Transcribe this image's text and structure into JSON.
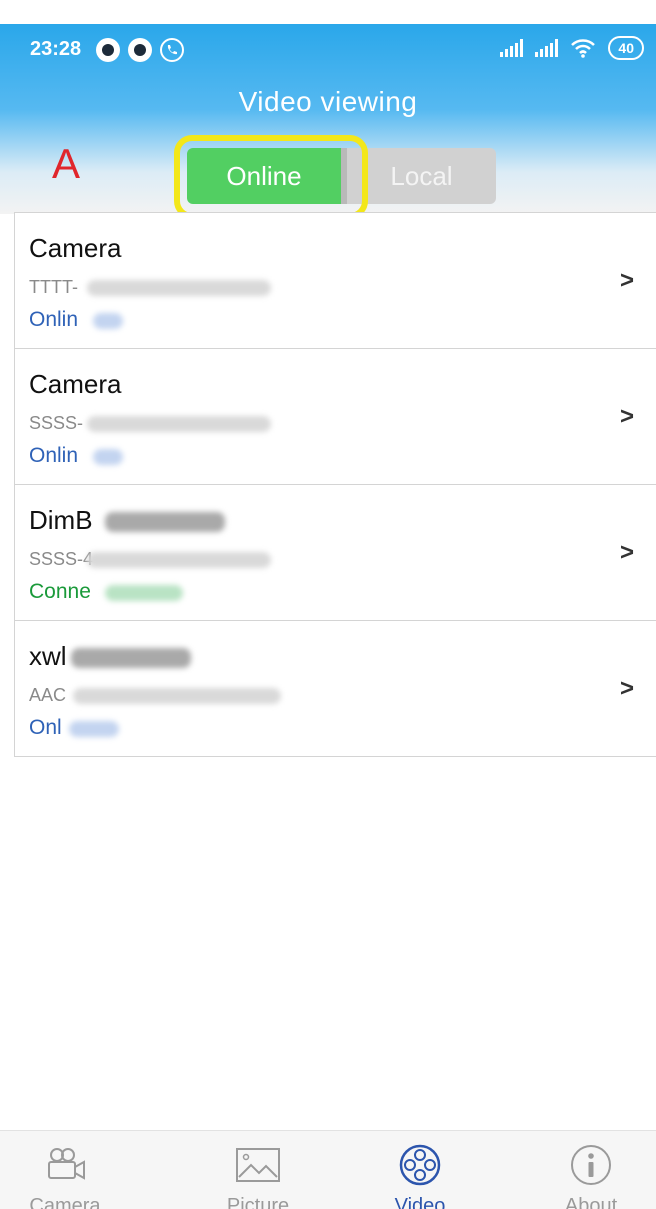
{
  "status_bar": {
    "time": "23:28",
    "battery": "40"
  },
  "header": {
    "title": "Video viewing",
    "annotation_letter": "A"
  },
  "segments": {
    "online": "Online",
    "local": "Local",
    "selected": "Online"
  },
  "devices": [
    {
      "name": "Camera",
      "id": "TTTT-",
      "status": "Onlin"
    },
    {
      "name": "Camera",
      "id": "SSSS-",
      "status": "Onlin"
    },
    {
      "name": "DimB",
      "id": "SSSS-4",
      "status": "Conne"
    },
    {
      "name": "xwl",
      "id": "AAC",
      "status": "Onl"
    }
  ],
  "bottom_nav": {
    "active": "Video",
    "tabs": [
      {
        "label": "Camera",
        "icon": "camera-icon"
      },
      {
        "label": "Picture",
        "icon": "picture-icon"
      },
      {
        "label": "Video",
        "icon": "video-reel-icon"
      },
      {
        "label": "About",
        "icon": "info-icon"
      }
    ]
  },
  "colors": {
    "header_blue": "#2aa7ea",
    "online_green": "#52cf62",
    "highlight_yellow": "#f3e71a",
    "status_online": "#2f62b7",
    "status_connecting": "#1a9a3a",
    "nav_active": "#2c55ad"
  }
}
